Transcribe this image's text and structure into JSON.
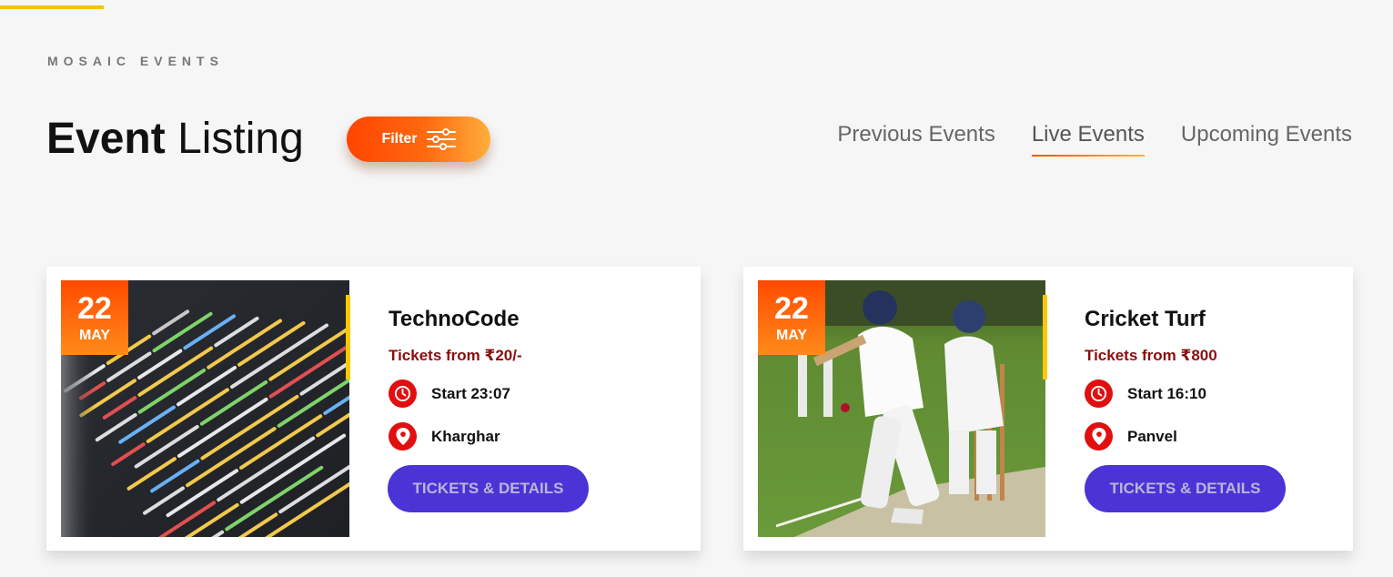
{
  "header": {
    "eyebrow": "MOSAIC EVENTS",
    "title_bold": "Event",
    "title_light": "Listing",
    "filter_label": "Filter"
  },
  "tabs": [
    {
      "label": "Previous Events",
      "active": false
    },
    {
      "label": "Live Events",
      "active": true
    },
    {
      "label": "Upcoming Events",
      "active": false
    }
  ],
  "events": [
    {
      "day": "22",
      "month": "MAY",
      "title": "TechnoCode",
      "price": "Tickets from ₹20/-",
      "time": "Start 23:07",
      "location": "Kharghar",
      "button": "TICKETS & DETAILS",
      "image": "code-screen"
    },
    {
      "day": "22",
      "month": "MAY",
      "title": "Cricket Turf",
      "price": "Tickets from ₹800",
      "time": "Start 16:10",
      "location": "Panvel",
      "button": "TICKETS & DETAILS",
      "image": "cricket-match"
    }
  ],
  "colors": {
    "accent_orange": "#ff4a00",
    "button_purple": "#4a34d6",
    "price_red": "#8b0e0e",
    "icon_red": "#e01010",
    "accent_yellow": "#f9c800"
  }
}
